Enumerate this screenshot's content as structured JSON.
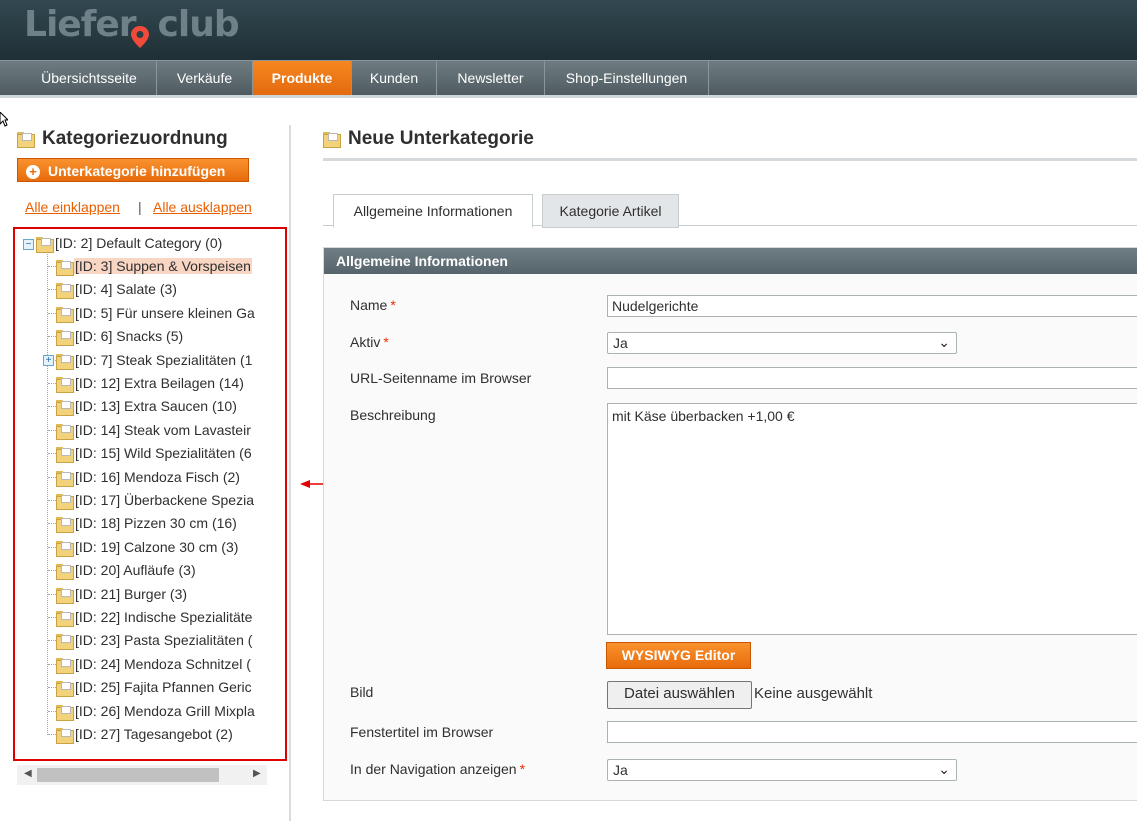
{
  "app": {
    "logo_left": "Liefer",
    "logo_right": "club"
  },
  "nav": {
    "items": [
      {
        "label": "Übersichtsseite",
        "active": false
      },
      {
        "label": "Verkäufe",
        "active": false
      },
      {
        "label": "Produkte",
        "active": true
      },
      {
        "label": "Kunden",
        "active": false
      },
      {
        "label": "Newsletter",
        "active": false
      },
      {
        "label": "Shop-Einstellungen",
        "active": false
      }
    ]
  },
  "left": {
    "title": "Kategoriezuordnung",
    "add_button": "Unterkategorie hinzufügen",
    "collapse_all": "Alle einklappen",
    "separator": "|",
    "expand_all": "Alle ausklappen",
    "tree": {
      "root": "[ID: 2] Default Category (0)",
      "items": [
        {
          "label": "[ID: 3] Suppen & Vorspeisen",
          "selected": true
        },
        {
          "label": "[ID: 4] Salate (3)"
        },
        {
          "label": "[ID: 5] Für unsere kleinen Ga"
        },
        {
          "label": "[ID: 6] Snacks (5)"
        },
        {
          "label": "[ID: 7] Steak Spezialitäten (1",
          "expandable": true
        },
        {
          "label": "[ID: 12] Extra Beilagen (14)"
        },
        {
          "label": "[ID: 13] Extra Saucen (10)"
        },
        {
          "label": "[ID: 14] Steak vom Lavasteir"
        },
        {
          "label": "[ID: 15] Wild Spezialitäten (6"
        },
        {
          "label": "[ID: 16] Mendoza Fisch (2)"
        },
        {
          "label": "[ID: 17] Überbackene Spezia"
        },
        {
          "label": "[ID: 18] Pizzen 30 cm (16)"
        },
        {
          "label": "[ID: 19] Calzone 30 cm (3)"
        },
        {
          "label": "[ID: 20] Aufläufe (3)"
        },
        {
          "label": "[ID: 21] Burger (3)"
        },
        {
          "label": "[ID: 22] Indische Spezialitäte"
        },
        {
          "label": "[ID: 23] Pasta Spezialitäten ("
        },
        {
          "label": "[ID: 24] Mendoza Schnitzel ("
        },
        {
          "label": "[ID: 25] Fajita Pfannen Geric"
        },
        {
          "label": "[ID: 26] Mendoza Grill Mixpla"
        },
        {
          "label": "[ID: 27] Tagesangebot (2)"
        }
      ]
    }
  },
  "right": {
    "title": "Neue Unterkategorie",
    "tabs": [
      {
        "label": "Allgemeine Informationen",
        "active": true
      },
      {
        "label": "Kategorie Artikel",
        "active": false
      }
    ],
    "section_header": "Allgemeine Informationen",
    "fields": {
      "name": {
        "label": "Name",
        "required": "*",
        "value": "Nudelgerichte"
      },
      "active": {
        "label": "Aktiv",
        "required": "*",
        "value": "Ja"
      },
      "url_key": {
        "label": "URL-Seitenname im Browser",
        "value": ""
      },
      "description": {
        "label": "Beschreibung",
        "value": "mit Käse überbacken +1,00 €"
      },
      "wysiwyg_button": "WYSIWYG Editor",
      "image": {
        "label": "Bild",
        "button": "Datei auswählen",
        "status": "Keine ausgewählt"
      },
      "window_title": {
        "label": "Fenstertitel im Browser",
        "value": ""
      },
      "in_navigation": {
        "label": "In der Navigation anzeigen",
        "required": "*",
        "value": "Ja"
      }
    }
  },
  "colors": {
    "accent": "#eb5e00",
    "header": "#2b3e45",
    "annotation": "#e00000"
  }
}
